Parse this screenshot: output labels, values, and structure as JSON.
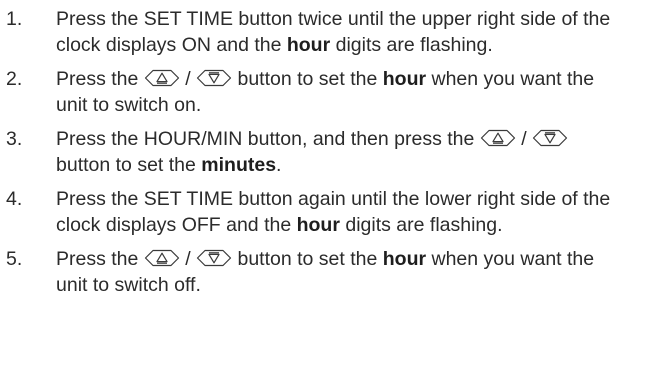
{
  "steps": [
    {
      "number": "1.",
      "t1": "Press the SET TIME button twice until the upper right side of the clock displays ON and the ",
      "b1": "hour",
      "t2": " digits are flashing."
    },
    {
      "number": "2.",
      "t1": "Press the ",
      "sep": " / ",
      "t2": " button to set the ",
      "b1": "hour",
      "t3": " when you want the unit to switch on."
    },
    {
      "number": "3.",
      "t1": "Press the HOUR/MIN button, and then press the ",
      "sep": " / ",
      "t2": " button to set the ",
      "b1": "minutes",
      "t3": "."
    },
    {
      "number": "4.",
      "t1": "Press the SET TIME button again until the lower right side of the clock displays OFF and the ",
      "b1": "hour",
      "t2": " digits are flashing."
    },
    {
      "number": "5.",
      "t1": "Press the ",
      "sep": " / ",
      "t2": " button to set the ",
      "b1": "hour",
      "t3": " when you want the unit to switch off."
    }
  ],
  "icons": {
    "up": "up-arrow-button-icon",
    "down": "down-arrow-button-icon"
  }
}
